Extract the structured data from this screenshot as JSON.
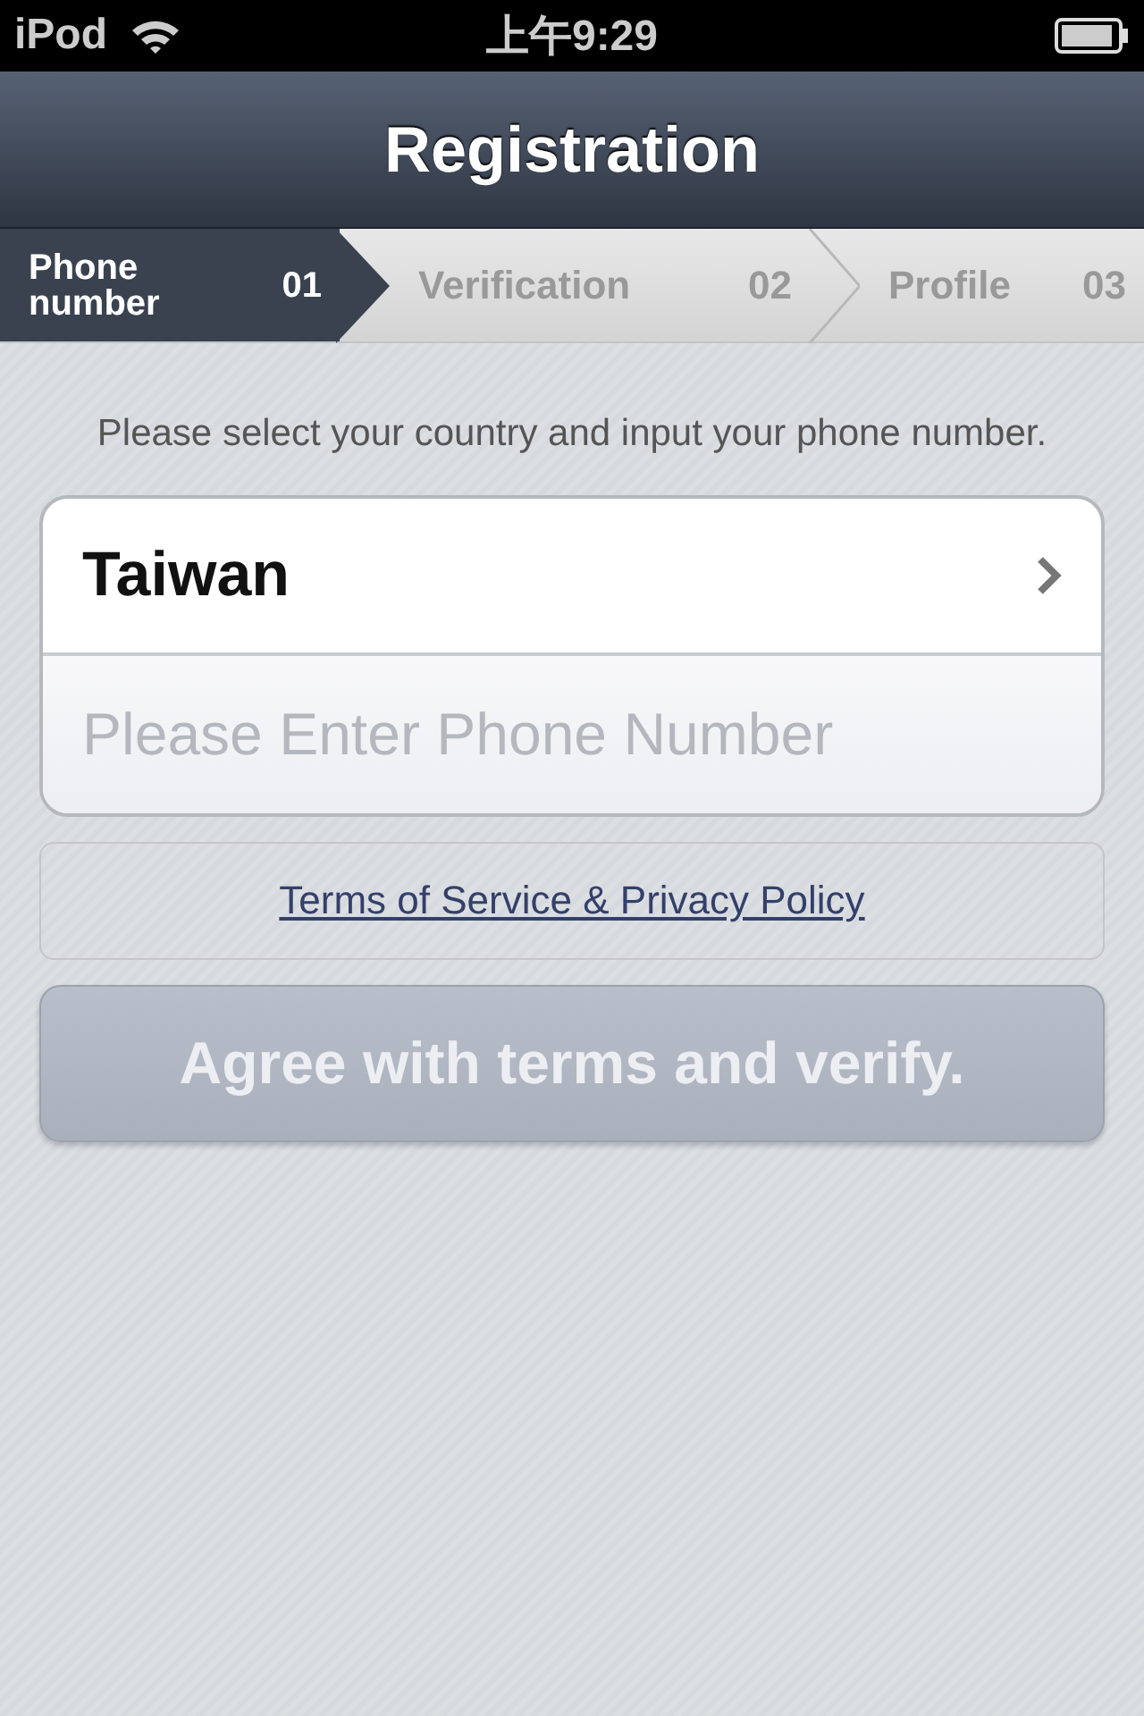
{
  "status_bar": {
    "carrier": "iPod",
    "time": "上午9:29"
  },
  "nav_bar": {
    "title": "Registration"
  },
  "steps": [
    {
      "label": "Phone number",
      "number": "01",
      "selected": true
    },
    {
      "label": "Verification",
      "number": "02",
      "selected": false
    },
    {
      "label": "Profile",
      "number": "03",
      "selected": false
    }
  ],
  "instruction": "Please select your country and input your phone number.",
  "form": {
    "country": "Taiwan",
    "phone_placeholder": "Please Enter Phone Number"
  },
  "terms_link": "Terms of Service & Privacy Policy",
  "submit_button": {
    "label": "Agree with terms and verify.",
    "disabled": true
  }
}
